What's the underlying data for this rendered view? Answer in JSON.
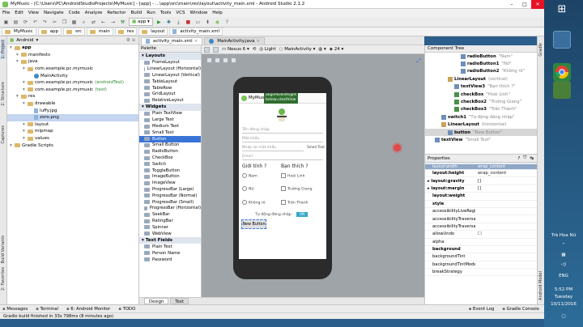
{
  "window": {
    "title": "MyMusic - [C:\\Users\\PC\\AndroidStudioProjects\\MyMusic] - [app] - ...\\app\\src\\main\\res\\layout\\activity_main.xml - Android Studio 2.1.2"
  },
  "menu": [
    "File",
    "Edit",
    "View",
    "Navigate",
    "Code",
    "Analyze",
    "Refactor",
    "Build",
    "Run",
    "Tools",
    "VCS",
    "Window",
    "Help"
  ],
  "toolbar": {
    "run_config": "app"
  },
  "breadcrumbs": [
    "MyMusic",
    "app",
    "src",
    "main",
    "res",
    "layout",
    "activity_main.xml"
  ],
  "left_strip": [
    "1: Project",
    "2: Structure",
    "Captures",
    "Build Variants",
    "2: Favorites"
  ],
  "right_strip": [
    "Gradle",
    "Android Model"
  ],
  "project": {
    "view": "Android",
    "items": [
      {
        "label": "app",
        "level": 0,
        "kind": "folder",
        "bold": true
      },
      {
        "label": "manifests",
        "level": 1,
        "kind": "folder"
      },
      {
        "label": "java",
        "level": 1,
        "kind": "folder"
      },
      {
        "label": "com.example.pc.mymusic",
        "level": 2,
        "kind": "folder"
      },
      {
        "label": "MainActivity",
        "level": 3,
        "kind": "class"
      },
      {
        "label": "com.example.pc.mymusic",
        "level": 2,
        "kind": "folder",
        "suffix": "(androidTest)"
      },
      {
        "label": "com.example.pc.mymusic",
        "level": 2,
        "kind": "folder",
        "suffix": "(test)"
      },
      {
        "label": "res",
        "level": 1,
        "kind": "folder"
      },
      {
        "label": "drawable",
        "level": 2,
        "kind": "folder"
      },
      {
        "label": "luffy.jpg",
        "level": 3,
        "kind": "file"
      },
      {
        "label": "zoro.png",
        "level": 3,
        "kind": "file",
        "selected": true
      },
      {
        "label": "layout",
        "level": 2,
        "kind": "folder"
      },
      {
        "label": "mipmap",
        "level": 2,
        "kind": "folder"
      },
      {
        "label": "values",
        "level": 2,
        "kind": "folder"
      },
      {
        "label": "Gradle Scripts",
        "level": 0,
        "kind": "folder"
      }
    ]
  },
  "editor_tabs": [
    {
      "label": "activity_main.xml",
      "active": true
    },
    {
      "label": "MainActivity.java",
      "active": false
    }
  ],
  "palette": {
    "title": "Palette",
    "sections": [
      {
        "name": "Layouts",
        "items": [
          "FrameLayout",
          "LinearLayout (Horizontal)",
          "LinearLayout (Vertical)",
          "TableLayout",
          "TableRow",
          "GridLayout",
          "RelativeLayout"
        ]
      },
      {
        "name": "Widgets",
        "items": [
          "Plain TextView",
          "Large Text",
          "Medium Text",
          "Small Text",
          "Button",
          "Small Button",
          "RadioButton",
          "CheckBox",
          "Switch",
          "ToggleButton",
          "ImageButton",
          "ImageView",
          "ProgressBar (Large)",
          "ProgressBar (Normal)",
          "ProgressBar (Small)",
          "ProgressBar (Horizontal)",
          "SeekBar",
          "RatingBar",
          "Spinner",
          "WebView"
        ]
      },
      {
        "name": "Text Fields",
        "items": [
          "Plain Text",
          "Person Name",
          "Password"
        ]
      }
    ],
    "selected": "Button"
  },
  "canvas": {
    "device": "Nexus 6",
    "theme": "Light",
    "activity": "MainActivity",
    "api": "24"
  },
  "phone": {
    "app_title": "MyMusic",
    "hint1": "alignParentRight",
    "hint2": "below=textView",
    "field_user": "Tên đăng nhập",
    "field_pass": "Mật khẩu",
    "field_repass": "Nhập lại mật khẩu",
    "small_text": "Small Text",
    "field_email": "Email",
    "gender_label": "Giới tính ?",
    "friend_label": "Bạn thích ?",
    "radios": [
      "Nam",
      "Nữ",
      "Không rõ"
    ],
    "checks": [
      "Hoài Linh",
      "Trường Giang",
      "Trấn Thành"
    ],
    "switch_label": "Tự động đăng nhập",
    "switch_state": "ON",
    "new_button": "New Button"
  },
  "design_tabs": [
    {
      "label": "Design",
      "active": true
    },
    {
      "label": "Text",
      "active": false
    }
  ],
  "component_tree": {
    "title": "Component Tree",
    "rows": [
      {
        "id": "radioButton",
        "hint": "\"Nam\"",
        "level": 5
      },
      {
        "id": "radioButton1",
        "hint": "\"Nữ\"",
        "level": 5
      },
      {
        "id": "radioButton2",
        "hint": "\"Không rõ\"",
        "level": 5
      },
      {
        "id": "LinearLayout",
        "hint": "(vertical)",
        "level": 3
      },
      {
        "id": "textView3",
        "hint": "\"Bạn thích ?\"",
        "level": 4
      },
      {
        "id": "checkBox",
        "hint": "\"Hoài Linh\"",
        "level": 4
      },
      {
        "id": "checkBox2",
        "hint": "\"Trường Giang\"",
        "level": 4
      },
      {
        "id": "checkBox3",
        "hint": "\"Trấn Thành\"",
        "level": 4
      },
      {
        "id": "switch1",
        "hint": "\"Tự động đăng nhập\"",
        "level": 2
      },
      {
        "id": "LinearLayout",
        "hint": "(horizontal)",
        "level": 2
      },
      {
        "id": "button",
        "hint": "\"New Button\"",
        "level": 3,
        "selected": true
      },
      {
        "id": "textView",
        "hint": "\"Small Text\"",
        "level": 1
      }
    ]
  },
  "properties": {
    "title": "Properties",
    "col_name": "layout:width",
    "col_value": "wrap_content",
    "rows": [
      {
        "k": "layout:height",
        "v": "wrap_content",
        "bold": true
      },
      {
        "k": "layout:gravity",
        "v": "[]",
        "bold": true,
        "exp": true
      },
      {
        "k": "layout:margin",
        "v": "[]",
        "bold": true,
        "exp": true
      },
      {
        "k": "layout:weight",
        "v": "",
        "bold": true
      },
      {
        "k": "style",
        "v": "",
        "bold": true
      },
      {
        "k": "accessibilityLiveRegion",
        "v": ""
      },
      {
        "k": "accessibilityTraversalAfte",
        "v": ""
      },
      {
        "k": "accessibilityTraversalBefc",
        "v": ""
      },
      {
        "k": "allowUndo",
        "v": "☐"
      },
      {
        "k": "alpha",
        "v": ""
      },
      {
        "k": "background",
        "v": "",
        "bold": true
      },
      {
        "k": "backgroundTint",
        "v": ""
      },
      {
        "k": "backgroundTintMode",
        "v": ""
      },
      {
        "k": "breakStrategy",
        "v": ""
      }
    ]
  },
  "status": {
    "tabs": [
      "Messages",
      "Terminal",
      "6: Android Monitor",
      "TODO"
    ],
    "right": [
      "Event Log",
      "Gradle Console"
    ],
    "message": "Gradle build finished in 33s 798ms (8 minutes ago)",
    "pos": "n/a",
    "extra": "Context: <no context>"
  },
  "taskbar": {
    "user": "Trà Hoa Nữ",
    "lang": "ENG",
    "time": "5:52 PM",
    "day": "Tuesday",
    "date": "10/11/2016"
  }
}
